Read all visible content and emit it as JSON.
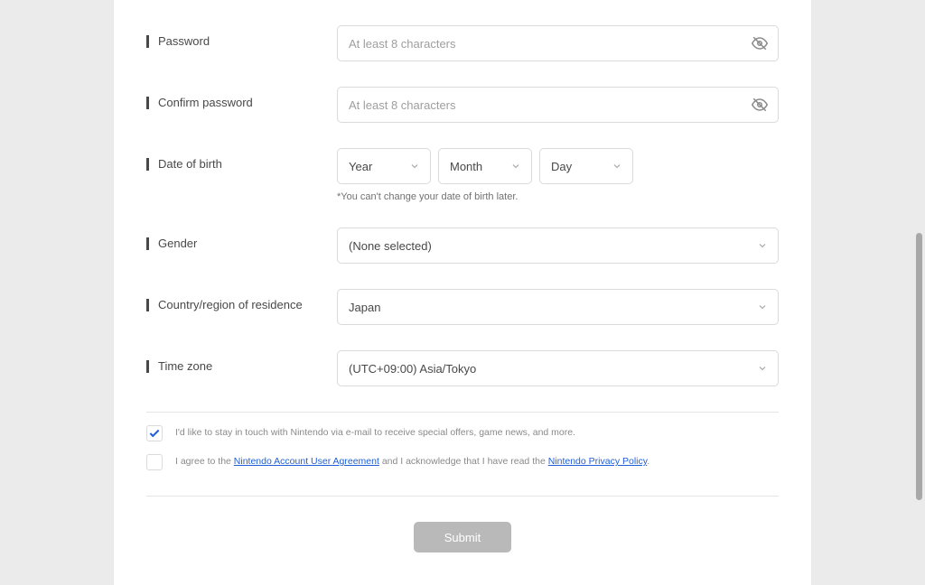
{
  "fields": {
    "password": {
      "label": "Password",
      "placeholder": "At least 8 characters"
    },
    "confirm_password": {
      "label": "Confirm password",
      "placeholder": "At least 8 characters"
    },
    "dob": {
      "label": "Date of birth",
      "year": "Year",
      "month": "Month",
      "day": "Day",
      "hint": "*You can't change your date of birth later."
    },
    "gender": {
      "label": "Gender",
      "value": "(None selected)"
    },
    "country": {
      "label": "Country/region of residence",
      "value": "Japan"
    },
    "timezone": {
      "label": "Time zone",
      "value": "(UTC+09:00) Asia/Tokyo"
    }
  },
  "checkboxes": {
    "newsletter": {
      "checked": true,
      "text": "I'd like to stay in touch with Nintendo via e-mail to receive special offers, game news, and more."
    },
    "agreement": {
      "checked": false,
      "prefix": "I agree to the ",
      "link1": "Nintendo Account User Agreement",
      "mid": " and I acknowledge that I have read the ",
      "link2": "Nintendo Privacy Policy",
      "suffix": "."
    }
  },
  "submit_label": "Submit"
}
